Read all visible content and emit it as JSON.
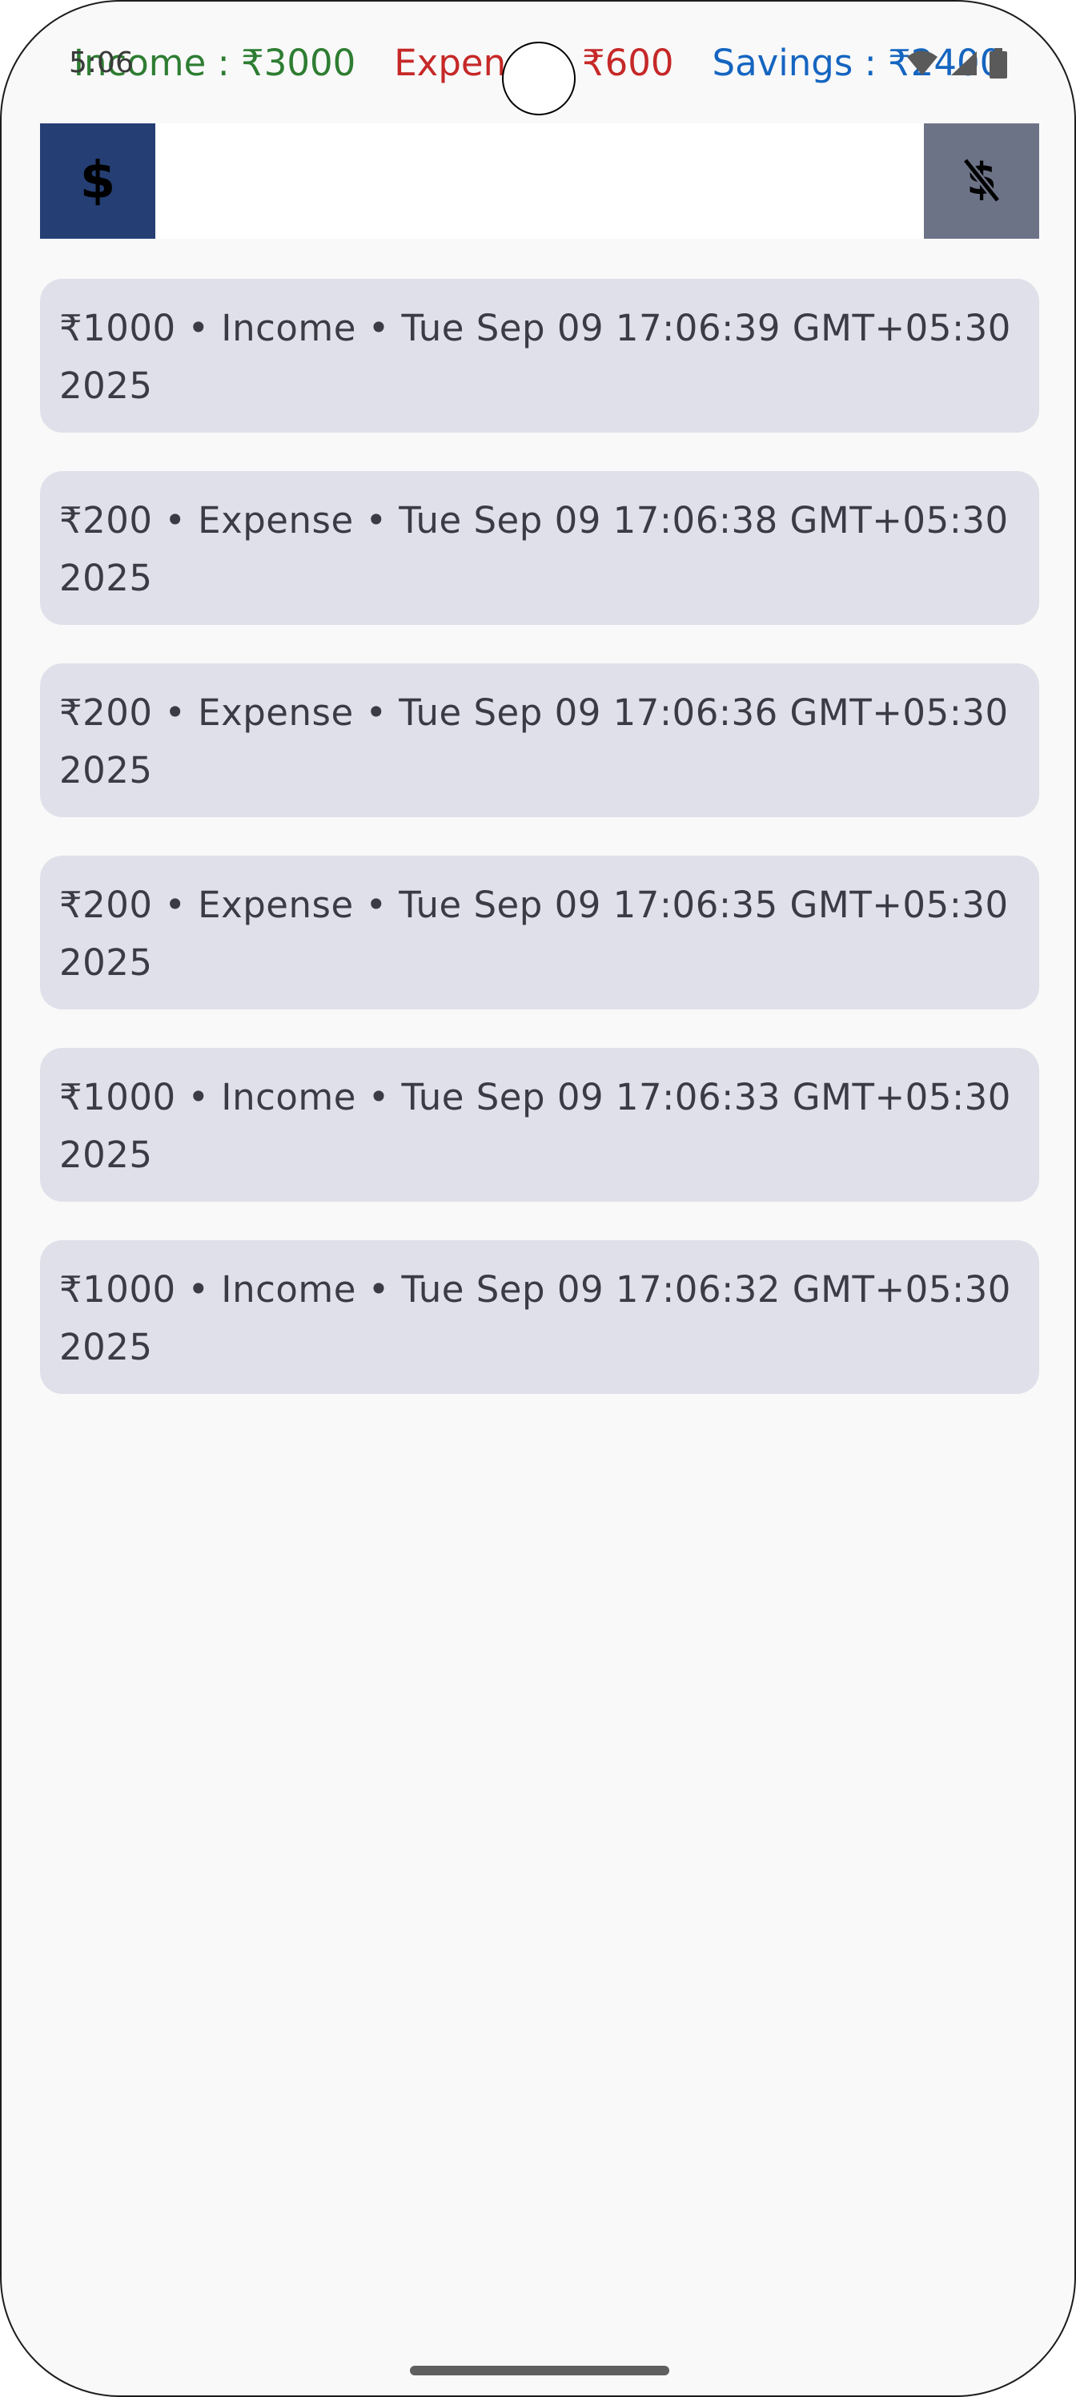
{
  "status_bar": {
    "time": "5:06",
    "icons": [
      "wifi-icon",
      "signal-icon",
      "battery-icon"
    ]
  },
  "summary": {
    "income": "Income : ₹3000",
    "expense": "Expense : ₹600",
    "savings": "Savings : ₹2400"
  },
  "actions": {
    "income_icon": "dollar-icon",
    "income_symbol": "$",
    "amount_value": "",
    "expense_icon": "money-off-icon"
  },
  "transactions": [
    {
      "text": "₹1000 • Income • Tue Sep 09 17:06:39 GMT+05:30 2025"
    },
    {
      "text": "₹200 • Expense • Tue Sep 09 17:06:38 GMT+05:30 2025"
    },
    {
      "text": "₹200 • Expense • Tue Sep 09 17:06:36 GMT+05:30 2025"
    },
    {
      "text": "₹200 • Expense • Tue Sep 09 17:06:35 GMT+05:30 2025"
    },
    {
      "text": "₹1000 • Income • Tue Sep 09 17:06:33 GMT+05:30 2025"
    },
    {
      "text": "₹1000 • Income • Tue Sep 09 17:06:32 GMT+05:30 2025"
    }
  ],
  "colors": {
    "income": "#2e7d32",
    "expense": "#c62828",
    "savings": "#1565c0",
    "income_button": "#253f74",
    "expense_button": "#6d7387",
    "card": "#e0e0ea",
    "background": "#f9f9f9"
  }
}
